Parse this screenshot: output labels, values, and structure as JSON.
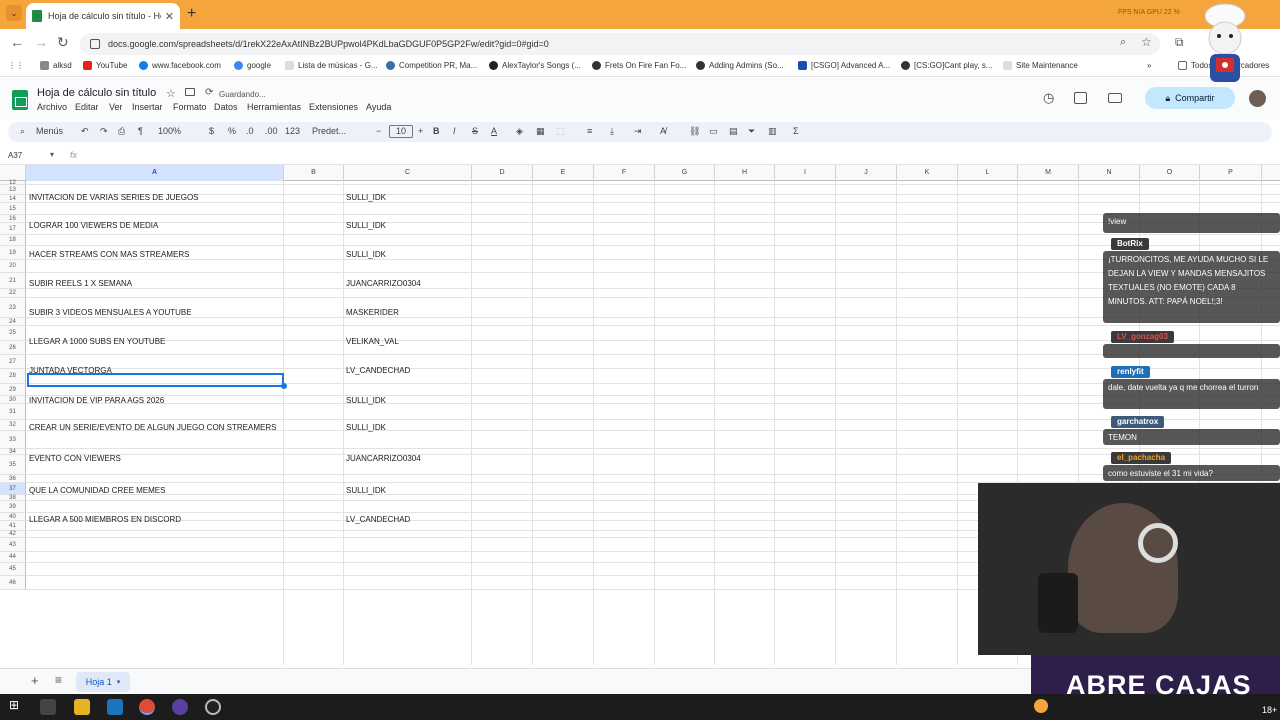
{
  "browser": {
    "tab_title": "Hoja de cálculo sin título - Hoja",
    "tab_close": "✕",
    "new_tab": "+",
    "right_info": "FPS N/A   GPU 22 %",
    "url": "docs.google.com/spreadsheets/d/1rekX22eAxAtINBz2BUPpwol4PKdLbaGDGUF0P5GP2Fw/edit?gid=0#gid=0",
    "bookmarks": [
      "alksd",
      "YouTube",
      "www.facebook.com",
      "google",
      "Lista de músicas - G...",
      "Competition PR, Ma...",
      "AlexTaylor's Songs (...",
      "Frets On Fire Fan Fo...",
      "Adding Admins (So...",
      "[CSGO] Advanced A...",
      "[CS:GO]Cant play, s...",
      "Site Maintenance"
    ],
    "bookmarks_more": "»",
    "all_bookmarks": "Todos los marcadores"
  },
  "doc": {
    "title": "Hoja de cálculo sin título",
    "saving": "Guardando...",
    "menus": [
      "Archivo",
      "Editar",
      "Ver",
      "Insertar",
      "Formato",
      "Datos",
      "Herramientas",
      "Extensiones",
      "Ayuda"
    ],
    "share": "Compartir"
  },
  "toolbar": {
    "menus": "Menús",
    "zoom": "100%",
    "currency": "$",
    "percent": "%",
    "dec_less": ".0",
    "dec_more": ".00",
    "num_format": "123",
    "font": "Predet...",
    "font_size": "10",
    "bold": "B",
    "italic": "I",
    "strike": "S",
    "textcolor": "A",
    "sum": "Σ"
  },
  "formula": {
    "cell_ref": "A37",
    "fx": "fx"
  },
  "columns": [
    "A",
    "B",
    "C",
    "D",
    "E",
    "F",
    "G",
    "H",
    "I",
    "J",
    "K",
    "L",
    "M",
    "N",
    "O",
    "P"
  ],
  "rows": [
    "12",
    "13",
    "14",
    "15",
    "16",
    "17",
    "18",
    "19",
    "20",
    "21",
    "22",
    "23",
    "24",
    "25",
    "26",
    "27",
    "28",
    "29",
    "30",
    "31",
    "32",
    "33",
    "34",
    "35",
    "36",
    "37",
    "38",
    "39",
    "40",
    "41",
    "42",
    "43",
    "44",
    "45",
    "46"
  ],
  "entries": [
    {
      "a": "INVITACION DE VARIAS SERIES DE JUEGOS",
      "c": "SULLI_IDK"
    },
    {
      "a": "LOGRAR 100 VIEWERS DE MEDIA",
      "c": "SULLI_IDK"
    },
    {
      "a": "HACER STREAMS CON MAS STREAMERS",
      "c": "SULLI_IDK"
    },
    {
      "a": "SUBIR REELS 1 X SEMANA",
      "c": "JUANCARRIZO0304"
    },
    {
      "a": "SUBIR 3 VIDEOS MENSUALES A YOUTUBE",
      "c": "MASKERIDER"
    },
    {
      "a": "LLEGAR A 1000 SUBS EN YOUTUBE",
      "c": "VELIKAN_VAL"
    },
    {
      "a": "JUNTADA VECTORGA",
      "c": "LV_CANDECHAD"
    },
    {
      "a": "INVITACION DE VIP PARA AGS 2026",
      "c": "SULLI_IDK"
    },
    {
      "a": "CREAR UN SERIE/EVENTO DE ALGUN JUEGO CON STREAMERS",
      "c": "SULLI_IDK"
    },
    {
      "a": "EVENTO CON VIEWERS",
      "c": "JUANCARRIZO0304"
    },
    {
      "a": "QUE LA COMUNIDAD CREE MEMES",
      "c": "SULLI_IDK"
    },
    {
      "a": "LLEGAR A 500 MIEMBROS EN DISCORD",
      "c": "LV_CANDECHAD"
    }
  ],
  "sheet_tab": "Hoja 1",
  "chat": {
    "m0": "!view",
    "u1": "BotRix",
    "m1": "¡TURRONCITOS, ME AYUDA MUCHO SI LE DEJAN LA VIEW Y MANDAS MENSAJITOS TEXTUALES (NO EMOTE) CADA 8 MINUTOS. ATT: PAPÁ NOEL!;3!",
    "u2": "LV_gonzag03",
    "u3": "renlyfit",
    "m3": "dale, date vuelta ya q me chorrea el turron",
    "u4": "garchatrox",
    "m4": "TEMON",
    "u5": "el_pachacha",
    "m5": "como estuviste el 31 mi vida?"
  },
  "overlay": {
    "banner": "ABRE CAJAS",
    "age": "18+"
  },
  "colors": {
    "tabbar": "#f4a53c",
    "accent": "#1a73e8",
    "share": "#c2e7ff",
    "sheets_green": "#0f9d58"
  }
}
